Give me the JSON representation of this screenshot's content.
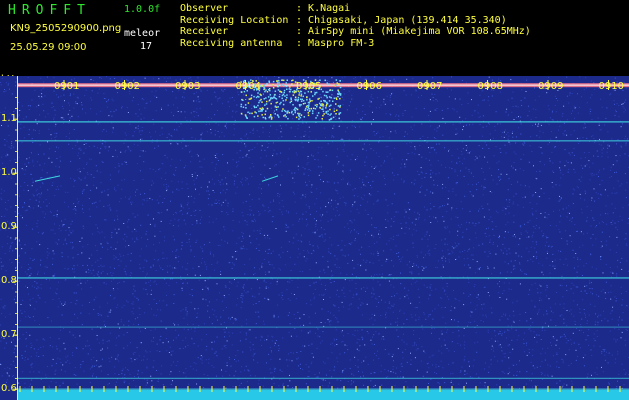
{
  "header": {
    "app_title": "HROFFT",
    "version": "1.0.0f",
    "filename": "KN9_2505290900.png",
    "mode": "meleor",
    "datetime": "25.05.29 09:00",
    "count": "17",
    "info": [
      {
        "key": "Observer",
        "value": "K.Nagai"
      },
      {
        "key": "Receiving Location",
        "value": "Chigasaki, Japan (139.414 35.340)"
      },
      {
        "key": "Receiver",
        "value": "AirSpy mini (Miakejima VOR 108.65MHz)"
      },
      {
        "key": "Receiving antenna",
        "value": "Maspro FM-3"
      }
    ]
  },
  "chart_data": {
    "type": "heatmap",
    "yunit": "kHz",
    "x_ticks": [
      "0901",
      "0902",
      "0903",
      "0904",
      "0905",
      "0906",
      "0907",
      "0908",
      "0909",
      "0910"
    ],
    "y_ticks": [
      "1.1",
      "1.0",
      "0.9",
      "0.8",
      "0.7",
      "0.6"
    ],
    "ylim": [
      0.58,
      1.18
    ],
    "colors": {
      "background": "#1c2a8c",
      "noise": "#3a5ad8",
      "line": "#3fd6e0",
      "carrier": "#ff7a8a",
      "axis": "#ffff40",
      "bottom_band": "#28c8e8"
    }
  }
}
